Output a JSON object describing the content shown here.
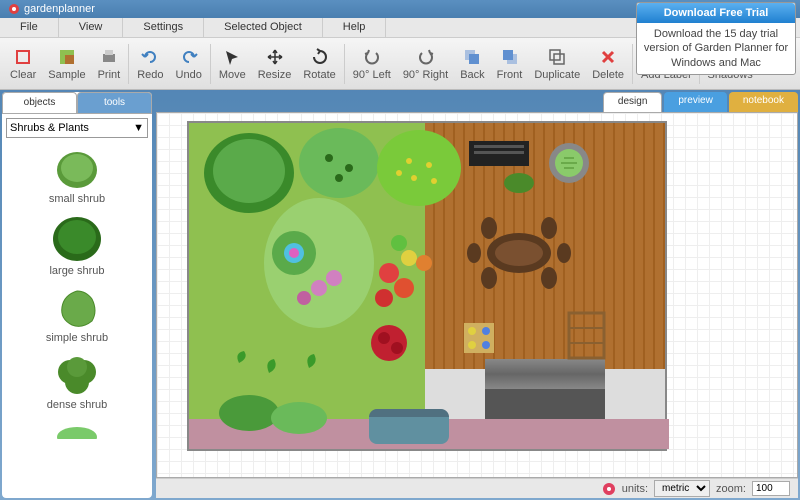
{
  "app": {
    "name": "gardenplanner"
  },
  "menu": {
    "file": "File",
    "view": "View",
    "settings": "Settings",
    "selected": "Selected Object",
    "help": "Help"
  },
  "toolbar": {
    "clear": "Clear",
    "sample": "Sample",
    "print": "Print",
    "redo": "Redo",
    "undo": "Undo",
    "move": "Move",
    "resize": "Resize",
    "rotate": "Rotate",
    "left90": "90° Left",
    "right90": "90° Right",
    "back": "Back",
    "front": "Front",
    "duplicate": "Duplicate",
    "delete": "Delete",
    "addlabel": "Add Label",
    "shadows": "Shadows"
  },
  "trial": {
    "button": "Download Free Trial",
    "text": "Download the 15 day trial version of Garden Planner for Windows and Mac"
  },
  "sidebar": {
    "tabs": {
      "objects": "objects",
      "tools": "tools"
    },
    "category": "Shrubs & Plants",
    "items": [
      "small shrub",
      "large shrub",
      "simple shrub",
      "dense shrub"
    ]
  },
  "canvastabs": {
    "design": "design",
    "preview": "preview",
    "notebook": "notebook"
  },
  "status": {
    "units": "units:",
    "units_val": "metric",
    "zoom": "zoom:",
    "zoom_val": "100"
  }
}
